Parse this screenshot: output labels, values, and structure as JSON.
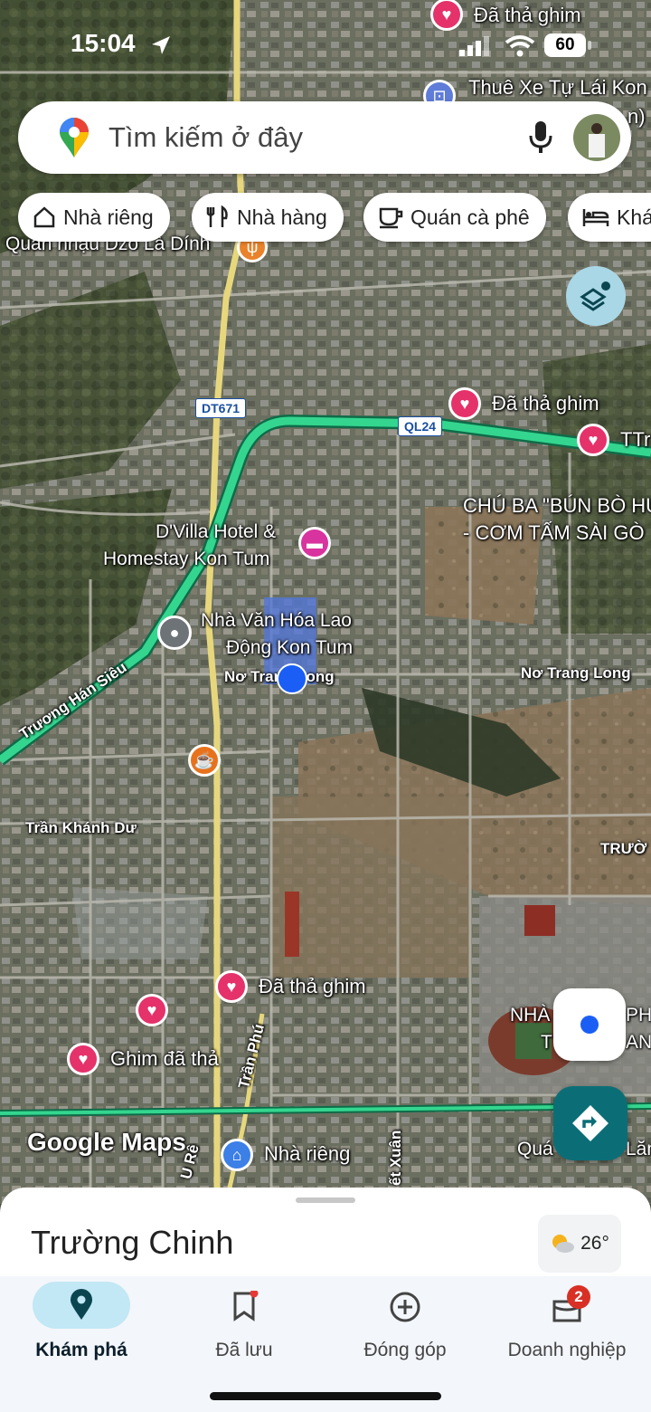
{
  "status_bar": {
    "time": "15:04",
    "battery": "60"
  },
  "search": {
    "placeholder": "Tìm kiếm ở đây"
  },
  "chips": [
    {
      "label": "Nhà riêng",
      "icon": "home-icon"
    },
    {
      "label": "Nhà hàng",
      "icon": "restaurant-icon"
    },
    {
      "label": "Quán cà phê",
      "icon": "coffee-icon"
    },
    {
      "label": "Khá",
      "icon": "hotel-icon"
    }
  ],
  "map": {
    "places": {
      "pinned_top": "Đã thả ghim",
      "rental": "Thuê Xe Tự Lái Kon",
      "rental_2": "n)",
      "pub": "Quán nhậu Dzo Là Dính",
      "pinned_1": "Đã thả ghim",
      "ttr": "TTr",
      "restaurant_1": "CHÚ BA \"BÚN BÒ HU",
      "restaurant_2": "- CƠM TẤM SÀI GÒ",
      "hotel_1": "D'Villa Hotel &",
      "hotel_2": "Homestay Kon Tum",
      "culture_1": "Nhà Văn Hóa Lao",
      "culture_2": "Động Kon Tum",
      "pinned_2": "Đã thả ghim",
      "pinned_3": "Ghim đã thả",
      "home": "Nhà riêng",
      "stadium_1": "NHÀ",
      "stadium_2": "PHO",
      "stadium_3": "T",
      "stadium_4": "AN",
      "qua": "Quá",
      "lat": "Lăn"
    },
    "roads": {
      "shield_dt": "DT671",
      "shield_ql": "QL24",
      "ntl_left": "Nơ Trang Long",
      "ntl_right": "Nơ Trang Long",
      "truong_han_sieu": "Trương Hán Siêu",
      "tran_khanh_du": "Trần Khánh Dư",
      "tran_phu": "Trần Phú",
      "u_re": "U Rê",
      "xuan": "ết Xuân",
      "truong": "TRƯỜ"
    },
    "watermark": "Google Maps"
  },
  "sheet": {
    "title": "Trường Chinh",
    "weather": "26°"
  },
  "nav": [
    {
      "label": "Khám phá",
      "icon": "explore-pin-icon"
    },
    {
      "label": "Đã lưu",
      "icon": "bookmark-icon"
    },
    {
      "label": "Đóng góp",
      "icon": "add-circle-icon"
    },
    {
      "label": "Doanh nghiệp",
      "icon": "business-icon",
      "badge": "2"
    }
  ],
  "colors": {
    "accent": "#0b5c67",
    "route": "#2bd28a",
    "pin": "#e5326b"
  }
}
